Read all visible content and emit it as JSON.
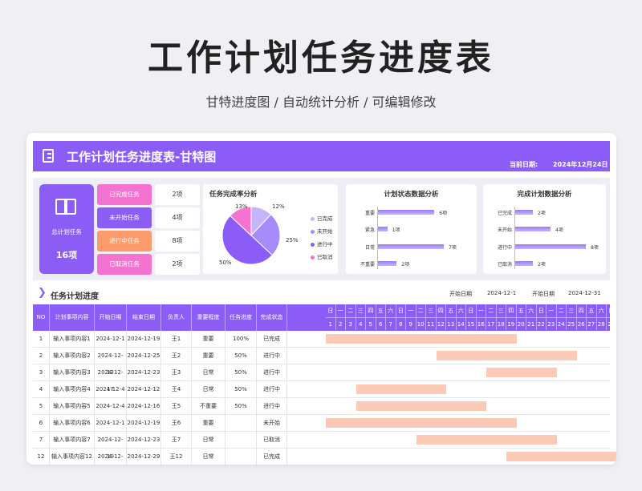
{
  "hero": {
    "title": "工作计划任务进度表",
    "subtitle": "甘特进度图  /  自动统计分析  / 可编辑修改"
  },
  "header": {
    "title": "工作计划任务进度表-甘特图",
    "date_label": "当前日期:",
    "date_value": "2024年12月24日"
  },
  "colors": {
    "accent": "#8b5cf6",
    "gantt_bar": "#fcc9b6"
  },
  "summary": {
    "total_label": "总计划任务",
    "total_value": "16项",
    "statuses": [
      {
        "label": "已完成任务",
        "value": "2项",
        "color": "#f472d0"
      },
      {
        "label": "未开始任务",
        "value": "4项",
        "color": "#8b5cf6"
      },
      {
        "label": "进行中任务",
        "value": "8项",
        "color": "#fb9a6b"
      },
      {
        "label": "已取消任务",
        "value": "2项",
        "color": "#f472d0"
      }
    ]
  },
  "pie_panel": {
    "title": "任务完成率分析",
    "slices": [
      {
        "label": "已完成",
        "percent": 12,
        "percent_label": "12%",
        "color": "#c4b5fd"
      },
      {
        "label": "未开始",
        "percent": 25,
        "percent_label": "25%",
        "color": "#a78bfa"
      },
      {
        "label": "进行中",
        "percent": 50,
        "percent_label": "50%",
        "color": "#8b5cf6"
      },
      {
        "label": "已取消",
        "percent": 13,
        "percent_label": "13%",
        "color": "#f472d0"
      }
    ]
  },
  "bar_panel_1": {
    "title": "计划状态数据分析",
    "max": 7,
    "rows": [
      {
        "label": "重要",
        "value": 6,
        "value_label": "6项"
      },
      {
        "label": "紧急",
        "value": 1,
        "value_label": "1项"
      },
      {
        "label": "日常",
        "value": 7,
        "value_label": "7项"
      },
      {
        "label": "不重要",
        "value": 2,
        "value_label": "2项"
      }
    ]
  },
  "bar_panel_2": {
    "title": "完成计划数据分析",
    "max": 8,
    "rows": [
      {
        "label": "已完成",
        "value": 2,
        "value_label": "2项"
      },
      {
        "label": "未开始",
        "value": 4,
        "value_label": "4项"
      },
      {
        "label": "进行中",
        "value": 8,
        "value_label": "8项"
      },
      {
        "label": "已取消",
        "value": 2,
        "value_label": "2项"
      }
    ]
  },
  "section": {
    "title": "任务计划进度",
    "start_label": "开始日期",
    "start_value": "2024-12-1",
    "end_label": "开始日期",
    "end_value": "2024-12-31"
  },
  "table": {
    "columns": [
      "NO",
      "计划事项内容",
      "开始日期",
      "结束日期",
      "负责人",
      "重要程度",
      "任务进度",
      "完成状态"
    ],
    "weekdays": [
      "日",
      "一",
      "二",
      "三",
      "四",
      "五",
      "六",
      "日",
      "一",
      "二",
      "三",
      "四",
      "五",
      "六",
      "日",
      "一",
      "二",
      "三",
      "四",
      "五",
      "六",
      "日",
      "一",
      "二",
      "三",
      "四",
      "五",
      "六",
      "日",
      "一",
      "二"
    ],
    "days": [
      "1",
      "2",
      "3",
      "4",
      "5",
      "6",
      "7",
      "8",
      "9",
      "10",
      "11",
      "12",
      "13",
      "14",
      "15",
      "16",
      "17",
      "18",
      "19",
      "20",
      "21",
      "22",
      "23",
      "24",
      "25",
      "26",
      "27",
      "28",
      "29",
      "30",
      "31"
    ],
    "rows": [
      {
        "no": "1",
        "content": "输入事项内容1",
        "start": "2024-12-1",
        "end": "2024-12-19",
        "owner": "王1",
        "importance": "重要",
        "progress": "100%",
        "status": "已完成",
        "bar": [
          1,
          19
        ]
      },
      {
        "no": "2",
        "content": "输入事项内容2",
        "start": "2024-12-12",
        "end": "2024-12-25",
        "owner": "王2",
        "importance": "重要",
        "progress": "50%",
        "status": "进行中",
        "bar": [
          12,
          25
        ]
      },
      {
        "no": "3",
        "content": "输入事项内容3",
        "start": "2024-12-17",
        "end": "2024-12-23",
        "owner": "王3",
        "importance": "日常",
        "progress": "50%",
        "status": "进行中",
        "bar": [
          17,
          23
        ]
      },
      {
        "no": "4",
        "content": "输入事项内容4",
        "start": "2024-12-4",
        "end": "2024-12-12",
        "owner": "王4",
        "importance": "日常",
        "progress": "50%",
        "status": "进行中",
        "bar": [
          4,
          12
        ]
      },
      {
        "no": "5",
        "content": "输入事项内容5",
        "start": "2024-12-4",
        "end": "2024-12-16",
        "owner": "王5",
        "importance": "不重要",
        "progress": "50%",
        "status": "进行中",
        "bar": [
          4,
          16
        ]
      },
      {
        "no": "6",
        "content": "输入事项内容6",
        "start": "2024-12-1",
        "end": "2024-12-19",
        "owner": "王6",
        "importance": "重要",
        "progress": "",
        "status": "未开始",
        "bar": [
          1,
          19
        ]
      },
      {
        "no": "7",
        "content": "输入事项内容7",
        "start": "2024-12-10",
        "end": "2024-12-23",
        "owner": "王7",
        "importance": "日常",
        "progress": "",
        "status": "已取消",
        "bar": [
          10,
          23
        ]
      },
      {
        "no": "12",
        "content": "输入事项内容12",
        "start": "2024-12-19",
        "end": "2024-12-29",
        "owner": "王12",
        "importance": "日常",
        "progress": "",
        "status": "已完成",
        "bar": [
          19,
          29
        ]
      }
    ]
  }
}
